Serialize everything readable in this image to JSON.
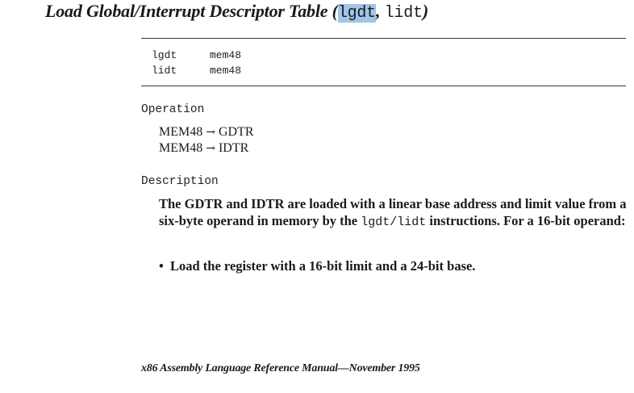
{
  "title": {
    "prefix": "Load Global/Interrupt Descriptor Table (",
    "mnemonic1": "lgdt",
    "separator": ",",
    "mnemonic2": "lidt",
    "suffix": ")"
  },
  "syntax": [
    {
      "mnemonic": "lgdt",
      "operand": "mem48"
    },
    {
      "mnemonic": "lidt",
      "operand": "mem48"
    }
  ],
  "operation": {
    "heading": "Operation",
    "lines": [
      {
        "src": "MEM48",
        "arrow": "→",
        "dst": "GDTR"
      },
      {
        "src": "MEM48",
        "arrow": "→",
        "dst": "IDTR"
      }
    ]
  },
  "description": {
    "heading": "Description",
    "text_before": "The GDTR and IDTR are loaded with a linear base address and limit value from a six-byte operand in memory by the ",
    "code": "lgdt/lidt",
    "text_after": " instructions. For a 16-bit operand:",
    "bullets": [
      "Load the register with a 16-bit limit and a 24-bit base."
    ],
    "bullet_symbol": "•"
  },
  "footer": "x86 Assembly Language Reference Manual—November 1995",
  "colors": {
    "highlight": "#9fc5e8",
    "rule": "#3a3a3a",
    "text": "#1a1a1a"
  }
}
